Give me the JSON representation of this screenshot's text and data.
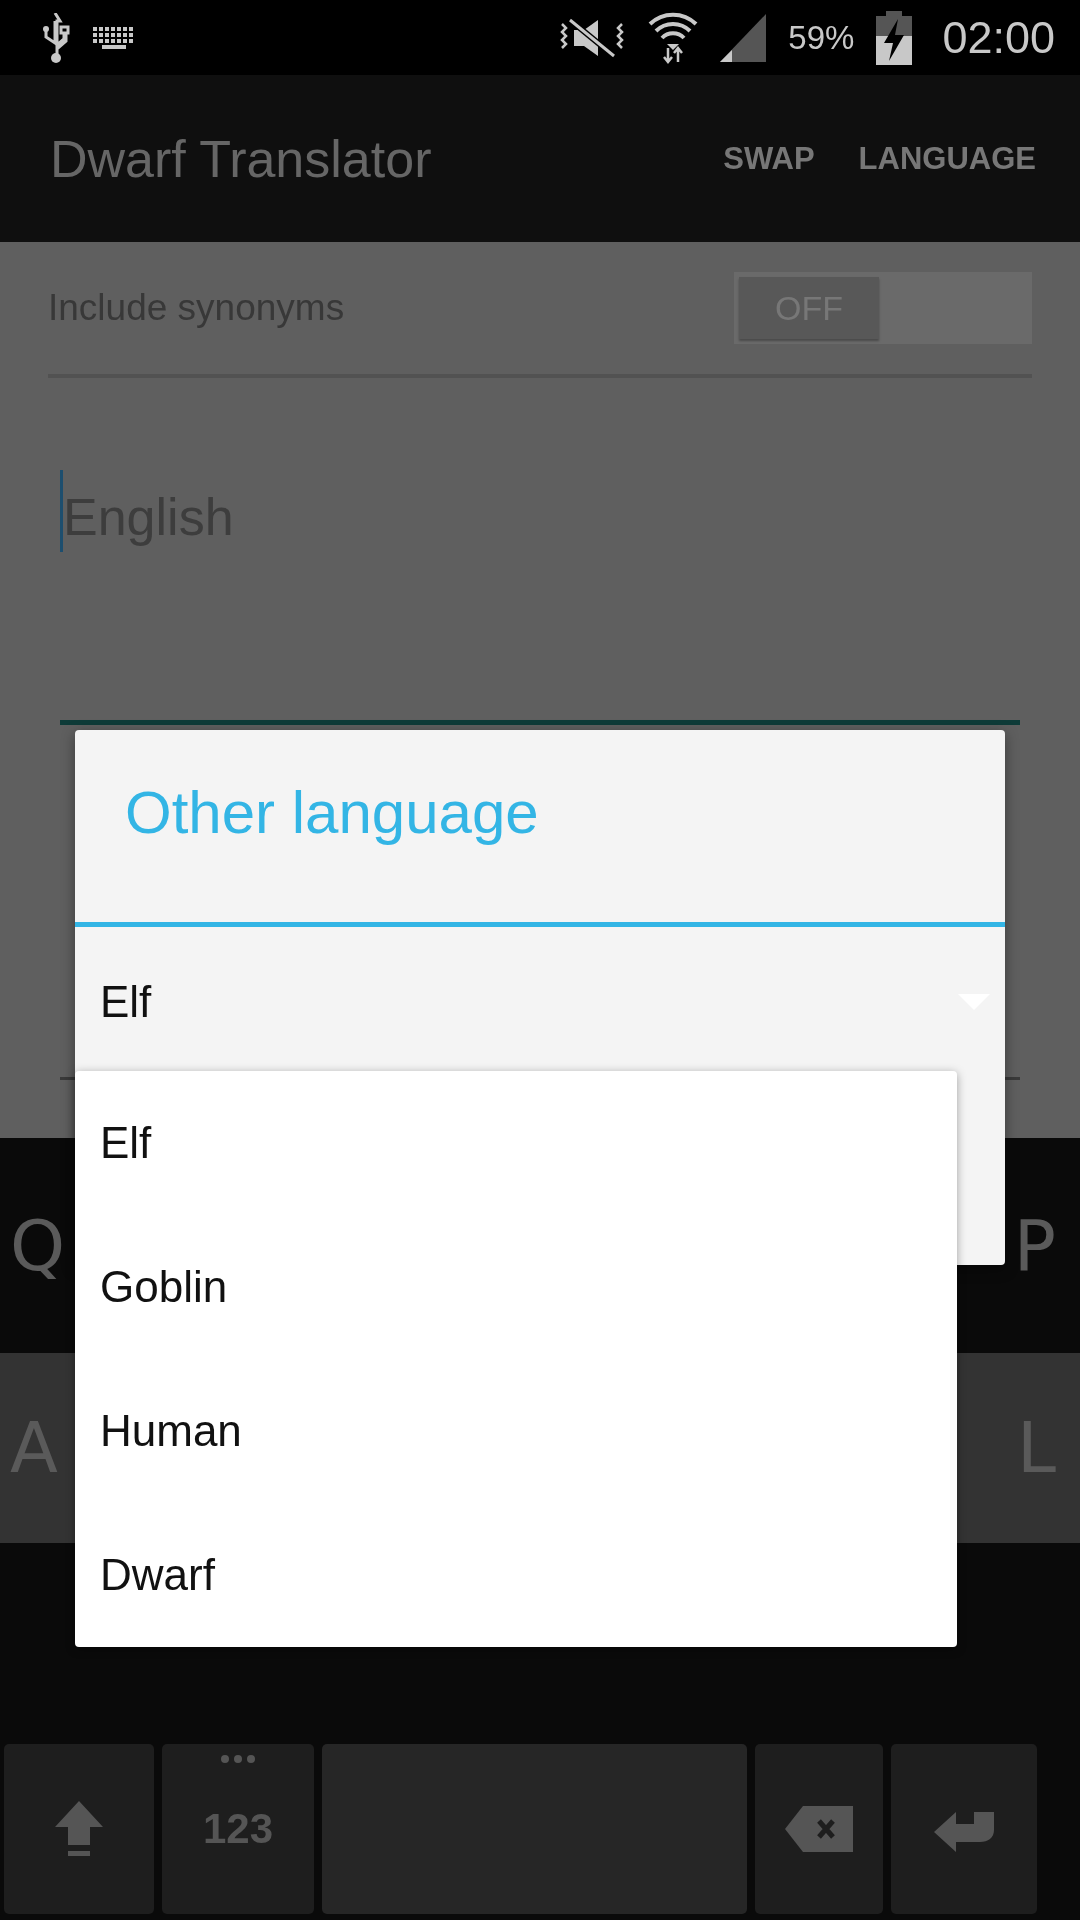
{
  "status_bar": {
    "battery": "59%",
    "time": "02:00"
  },
  "app_bar": {
    "title": "Dwarf Translator",
    "actions": [
      "SWAP",
      "LANGUAGE"
    ]
  },
  "synonyms": {
    "label": "Include synonyms",
    "switch": {
      "label": "OFF",
      "on": false
    }
  },
  "input": {
    "placeholder": "English"
  },
  "dialog": {
    "title": "Other language",
    "spinner": {
      "value": "Elf"
    },
    "options": [
      {
        "label": "Elf"
      },
      {
        "label": "Goblin"
      },
      {
        "label": "Human"
      },
      {
        "label": "Dwarf"
      }
    ]
  },
  "keyboard": {
    "rows": [
      [
        "Q",
        "P"
      ],
      [
        "A",
        "L"
      ]
    ],
    "keys": [
      {
        "kind": "shift"
      },
      {
        "kind": "symbols",
        "label": "123"
      },
      {
        "kind": "space"
      },
      {
        "kind": "backspace"
      },
      {
        "kind": "enter"
      }
    ]
  }
}
